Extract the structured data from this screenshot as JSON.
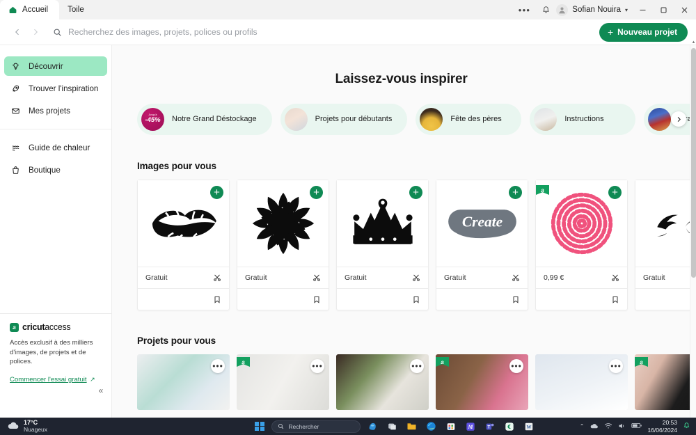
{
  "titlebar": {
    "tabs": [
      {
        "label": "Accueil",
        "icon": "cricut-logo-icon",
        "active": true
      },
      {
        "label": "Toile",
        "icon": "",
        "active": false
      }
    ],
    "overflow_icon": "more-horizontal-icon",
    "notification_icon": "bell-icon",
    "user_name": "Sofian Nouira",
    "user_chevron": "chevron-down-icon",
    "window_minimize": "minimize-icon",
    "window_restore": "restore-icon",
    "window_close": "close-icon"
  },
  "toolbar": {
    "back_icon": "chevron-left-icon",
    "forward_icon": "chevron-right-icon",
    "search_icon": "search-icon",
    "search_placeholder": "Recherchez des images, projets, polices ou profils",
    "search_value": "",
    "new_project_label": "Nouveau projet",
    "new_project_icon": "plus-icon",
    "accent_green": "#0f8a54"
  },
  "sidebar": {
    "items": [
      {
        "label": "Découvrir",
        "icon": "lightbulb-icon",
        "active": true
      },
      {
        "label": "Trouver l'inspiration",
        "icon": "rocket-icon",
        "active": false
      },
      {
        "label": "Mes projets",
        "icon": "envelope-icon",
        "active": false
      }
    ],
    "items2": [
      {
        "label": "Guide de chaleur",
        "icon": "heat-waves-icon",
        "active": false
      },
      {
        "label": "Boutique",
        "icon": "shopping-bag-icon",
        "active": false
      }
    ],
    "access": {
      "brand_bold": "cricut",
      "brand_light": "access",
      "mark": "a",
      "description": "Accès exclusif à des milliers d'images, de projets et de polices.",
      "link": "Commencer l'essai gratuit",
      "link_icon": "external-arrow-icon"
    },
    "collapse_icon": "chevron-double-left-icon"
  },
  "main": {
    "page_title": "Laissez-vous inspirer",
    "pills": [
      {
        "label": "Notre Grand Déstockage",
        "thumb": "discount-badge",
        "badge_text": "-45%",
        "badge_top": "Jusqu'à"
      },
      {
        "label": "Projets pour débutants",
        "thumb": "photo-beginner"
      },
      {
        "label": "Fête des pères",
        "thumb": "photo-fathersday"
      },
      {
        "label": "Instructions",
        "thumb": "photo-instructions"
      },
      {
        "label": "Graduatio",
        "thumb": "photo-graduation"
      }
    ],
    "pills_next_icon": "chevron-right-icon",
    "images_section": {
      "title": "Images pour vous",
      "cards": [
        {
          "art": "lips",
          "price": "Gratuit",
          "cut_icon": "scissors-icon",
          "save_icon": "bookmark-icon",
          "add_icon": "plus-icon",
          "access_flag": false
        },
        {
          "art": "sunflower",
          "price": "Gratuit",
          "cut_icon": "scissors-icon",
          "save_icon": "bookmark-icon",
          "add_icon": "plus-icon",
          "access_flag": false
        },
        {
          "art": "crown",
          "price": "Gratuit",
          "cut_icon": "scissors-icon",
          "save_icon": "bookmark-icon",
          "add_icon": "plus-icon",
          "access_flag": false
        },
        {
          "art": "create-script",
          "price": "Gratuit",
          "cut_icon": "scissors-icon",
          "save_icon": "bookmark-icon",
          "add_icon": "plus-icon",
          "access_flag": false
        },
        {
          "art": "pink-spiral-rose",
          "price": "0,99 €",
          "cut_icon": "scissors-icon",
          "save_icon": "bookmark-icon",
          "add_icon": "plus-icon",
          "access_flag": true
        },
        {
          "art": "dolphins",
          "price": "Gratuit",
          "cut_icon": "scissors-icon",
          "save_icon": "bookmark-icon",
          "add_icon": "plus-icon",
          "access_flag": false
        }
      ]
    },
    "projects_section": {
      "title": "Projets pour vous",
      "cards": [
        {
          "art": "photo-cards-mint",
          "menu_icon": "more-horizontal-icon",
          "access_flag": false
        },
        {
          "art": "photo-lettering-board",
          "menu_icon": "more-horizontal-icon",
          "access_flag": true
        },
        {
          "art": "photo-plant-shelf",
          "menu_icon": "more-horizontal-icon",
          "access_flag": false
        },
        {
          "art": "photo-pink-rosettes",
          "menu_icon": "more-horizontal-icon",
          "access_flag": true
        },
        {
          "art": "photo-bug-card",
          "menu_icon": "more-horizontal-icon",
          "access_flag": false
        },
        {
          "art": "photo-chalkboard",
          "menu_icon": "more-horizontal-icon",
          "access_flag": true
        }
      ]
    }
  },
  "taskbar": {
    "weather_temp": "17°C",
    "weather_desc": "Nuageux",
    "weather_icon": "cloud-icon",
    "start_icon": "windows-start-icon",
    "search_icon": "search-icon",
    "search_placeholder": "Rechercher",
    "copilot_icon": "copilot-icon",
    "apps": [
      {
        "name": "task-view-icon"
      },
      {
        "name": "file-explorer-icon"
      },
      {
        "name": "edge-icon"
      },
      {
        "name": "store-icon"
      },
      {
        "name": "mathsolver-icon"
      },
      {
        "name": "teams-icon"
      },
      {
        "name": "cricut-design-space-icon"
      },
      {
        "name": "word-icon"
      }
    ],
    "tray": {
      "chevron": "chevron-up-icon",
      "onedrive": "onedrive-icon",
      "wifi": "wifi-icon",
      "volume": "volume-icon",
      "battery": "battery-icon",
      "time": "20:53",
      "date": "16/06/2024",
      "notification": "bell-icon"
    }
  }
}
